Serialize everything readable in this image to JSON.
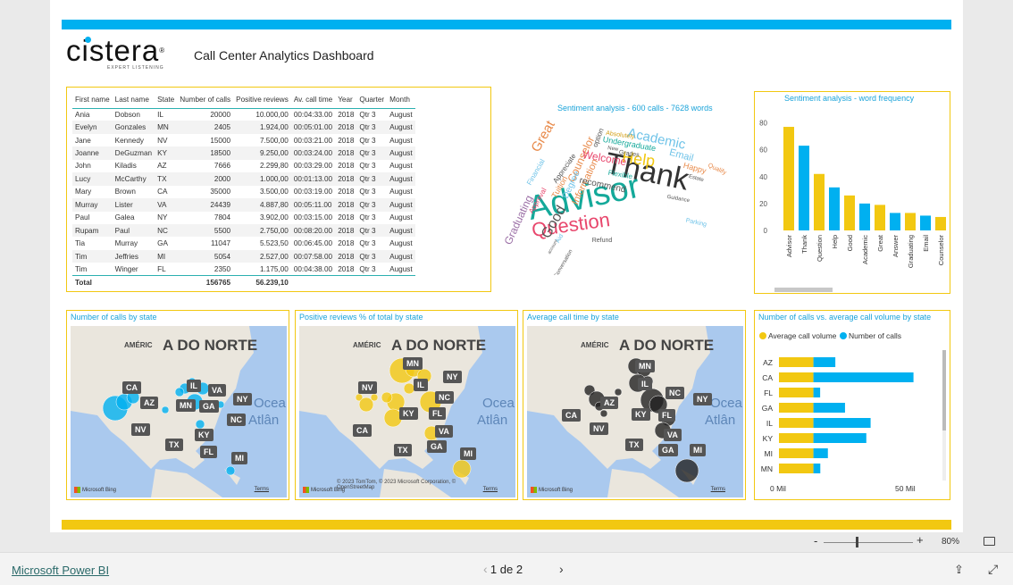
{
  "header": {
    "logo": "cistera",
    "logo_tagline": "EXPERT LISTENING",
    "title": "Call Center Analytics Dashboard"
  },
  "table": {
    "columns": [
      "First name",
      "Last name",
      "State",
      "Number of calls",
      "Positive reviews",
      "Av. call time",
      "Year",
      "Quarter",
      "Month"
    ],
    "rows": [
      [
        "Ania",
        "Dobson",
        "IL",
        "20000",
        "10.000,00",
        "00:04:33.00",
        "2018",
        "Qtr 3",
        "August"
      ],
      [
        "Evelyn",
        "Gonzales",
        "MN",
        "2405",
        "1.924,00",
        "00:05:01.00",
        "2018",
        "Qtr 3",
        "August"
      ],
      [
        "Jane",
        "Kennedy",
        "NV",
        "15000",
        "7.500,00",
        "00:03:21.00",
        "2018",
        "Qtr 3",
        "August"
      ],
      [
        "Joanne",
        "DeGuzman",
        "KY",
        "18500",
        "9.250,00",
        "00:03:24.00",
        "2018",
        "Qtr 3",
        "August"
      ],
      [
        "John",
        "Kiladis",
        "AZ",
        "7666",
        "2.299,80",
        "00:03:29.00",
        "2018",
        "Qtr 3",
        "August"
      ],
      [
        "Lucy",
        "McCarthy",
        "TX",
        "2000",
        "1.000,00",
        "00:01:13.00",
        "2018",
        "Qtr 3",
        "August"
      ],
      [
        "Mary",
        "Brown",
        "CA",
        "35000",
        "3.500,00",
        "00:03:19.00",
        "2018",
        "Qtr 3",
        "August"
      ],
      [
        "Murray",
        "Lister",
        "VA",
        "24439",
        "4.887,80",
        "00:05:11.00",
        "2018",
        "Qtr 3",
        "August"
      ],
      [
        "Paul",
        "Galea",
        "NY",
        "7804",
        "3.902,00",
        "00:03:15.00",
        "2018",
        "Qtr 3",
        "August"
      ],
      [
        "Rupam",
        "Paul",
        "NC",
        "5500",
        "2.750,00",
        "00:08:20.00",
        "2018",
        "Qtr 3",
        "August"
      ],
      [
        "Tia",
        "Murray",
        "GA",
        "11047",
        "5.523,50",
        "00:06:45.00",
        "2018",
        "Qtr 3",
        "August"
      ],
      [
        "Tim",
        "Jeffries",
        "MI",
        "5054",
        "2.527,00",
        "00:07:58.00",
        "2018",
        "Qtr 3",
        "August"
      ],
      [
        "Tim",
        "Winger",
        "FL",
        "2350",
        "1.175,00",
        "00:04:38.00",
        "2018",
        "Qtr 3",
        "August"
      ]
    ],
    "total": {
      "label": "Total",
      "calls": "156765",
      "reviews": "56.239,10"
    }
  },
  "wordcloud": {
    "title": "Sentiment analysis - 600 calls - 7628 words",
    "words": [
      {
        "t": "Advisor",
        "c": "#14a99a"
      },
      {
        "t": "Thank",
        "c": "#333333"
      },
      {
        "t": "Question",
        "c": "#e8466c"
      },
      {
        "t": "Academic",
        "c": "#6fc3e8"
      },
      {
        "t": "Help",
        "c": "#f2c811"
      },
      {
        "t": "Good",
        "c": "#555555"
      },
      {
        "t": "Great",
        "c": "#e88a4a"
      },
      {
        "t": "Graduating",
        "c": "#9b6fa6"
      },
      {
        "t": "Counselor",
        "c": "#e88a4a"
      },
      {
        "t": "Welcome",
        "c": "#e8466c"
      },
      {
        "t": "Email",
        "c": "#6fc3e8"
      },
      {
        "t": "Information",
        "c": "#e88a4a"
      },
      {
        "t": "recommend",
        "c": "#555555"
      },
      {
        "t": "Degree",
        "c": "#6fc3e8"
      },
      {
        "t": "Undergraduate",
        "c": "#14a99a"
      },
      {
        "t": "Happy",
        "c": "#e88a4a"
      },
      {
        "t": "Flexible",
        "c": "#14a99a"
      },
      {
        "t": "Financial",
        "c": "#6fc3e8"
      },
      {
        "t": "Appreciate",
        "c": "#555555"
      },
      {
        "t": "Approval",
        "c": "#e8466c"
      },
      {
        "t": "Tuition",
        "c": "#e88a4a"
      },
      {
        "t": "Absolutely",
        "c": "#d4a017"
      },
      {
        "t": "option",
        "c": "#555555"
      },
      {
        "t": "Grades",
        "c": "#555555"
      },
      {
        "t": "New",
        "c": "#555555"
      },
      {
        "t": "Qualify",
        "c": "#e88a4a"
      },
      {
        "t": "Estate",
        "c": "#555555"
      },
      {
        "t": "Guidance",
        "c": "#555555"
      },
      {
        "t": "Parking",
        "c": "#6fc3e8"
      },
      {
        "t": "Refund",
        "c": "#555555"
      },
      {
        "t": "Conversation",
        "c": "#555555"
      },
      {
        "t": "account",
        "c": "#555555"
      },
      {
        "t": "Aid",
        "c": "#6fc3e8"
      }
    ]
  },
  "freq_chart": {
    "title": "Sentiment analysis - word frequency",
    "chart_data": {
      "type": "bar",
      "categories": [
        "Advisor",
        "Thank",
        "Question",
        "Help",
        "Good",
        "Academic",
        "Great",
        "Answer",
        "Graduating",
        "Email",
        "Counselor"
      ],
      "values": [
        77,
        63,
        42,
        32,
        26,
        20,
        19,
        13,
        13,
        11,
        10
      ],
      "colors": [
        "#f2c811",
        "#00b0f0",
        "#f2c811",
        "#00b0f0",
        "#f2c811",
        "#00b0f0",
        "#f2c811",
        "#00b0f0",
        "#f2c811",
        "#00b0f0",
        "#f2c811"
      ],
      "yticks": [
        0,
        20,
        40,
        60,
        80
      ],
      "ylim": [
        0,
        85
      ]
    }
  },
  "maps": [
    {
      "title": "Number of calls by state",
      "bubble": "#00b0f0",
      "attribution": "",
      "states": [
        "CA",
        "AZ",
        "NV",
        "IL",
        "VA",
        "MN",
        "GA",
        "NY",
        "NC",
        "KY",
        "TX",
        "FL",
        "MI"
      ]
    },
    {
      "title": "Positive reviews % of total by state",
      "bubble": "#f2c811",
      "attribution": "© 2023 TomTom, © 2023 Microsoft Corporation, © OpenStreetMap",
      "states": [
        "MN",
        "NY",
        "IL",
        "NV",
        "NC",
        "KY",
        "FL",
        "CA",
        "VA",
        "TX",
        "GA",
        "MI"
      ]
    },
    {
      "title": "Average call time by state",
      "bubble": "#222222",
      "attribution": "",
      "states": [
        "MN",
        "IL",
        "NC",
        "AZ",
        "CA",
        "KY",
        "FL",
        "NV",
        "NY",
        "VA",
        "TX",
        "GA",
        "MI"
      ]
    }
  ],
  "map_text": {
    "continent_a": "AMÉRIC",
    "continent_b": "A DO NORTE",
    "ocean_a": "Ocea",
    "ocean_b": "Atlân",
    "bing": "Microsoft Bing",
    "terms": "Terms"
  },
  "hbar": {
    "title": "Number of calls vs. average call volume by state",
    "legend": [
      {
        "name": "Average call volume",
        "color": "#f2c811"
      },
      {
        "name": "Number of calls",
        "color": "#00b0f0"
      }
    ],
    "chart_data": {
      "type": "bar",
      "categories": [
        "AZ",
        "CA",
        "FL",
        "GA",
        "IL",
        "KY",
        "MI",
        "MN"
      ],
      "series": [
        {
          "name": "Average call volume",
          "values": [
            12.06,
            12.06,
            12.06,
            12.06,
            12.06,
            12.06,
            12.06,
            12.06
          ]
        },
        {
          "name": "Number of calls",
          "values": [
            7.666,
            35,
            2.35,
            11.047,
            20,
            18.5,
            5.054,
            2.405
          ]
        }
      ],
      "xticks": [
        "0 Mil",
        "50 Mil"
      ],
      "xlim": [
        0,
        50
      ]
    }
  },
  "status": {
    "zoom_minus": "-",
    "zoom_plus": "+",
    "zoom": "80%"
  },
  "footer": {
    "brand": "Microsoft Power BI",
    "page": "1 de 2",
    "prev": "‹",
    "next": "›"
  }
}
